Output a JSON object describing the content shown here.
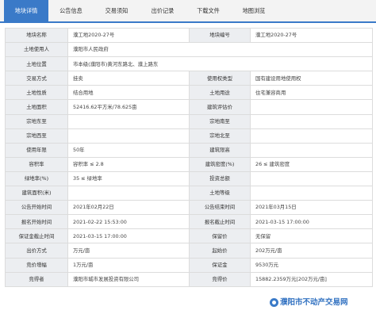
{
  "tabs": [
    "地块详情",
    "公告信息",
    "交易须知",
    "出价记录",
    "下载文件",
    "地图浏览"
  ],
  "rows": [
    [
      {
        "t": "l",
        "v": "地块名称"
      },
      {
        "t": "v",
        "v": "濮工地2020-27号"
      },
      {
        "t": "l",
        "v": "地块编号"
      },
      {
        "t": "v",
        "v": "濮工地2020-27号"
      }
    ],
    [
      {
        "t": "l",
        "v": "土地使用人"
      },
      {
        "t": "v",
        "v": "濮阳市人民政府",
        "cs": 3
      }
    ],
    [
      {
        "t": "l",
        "v": "土地位置"
      },
      {
        "t": "v",
        "v": "市本级(濮阳市)黄河东路北、濮上路东",
        "cs": 3
      }
    ],
    [
      {
        "t": "l",
        "v": "交易方式"
      },
      {
        "t": "v",
        "v": "挂卖"
      },
      {
        "t": "l",
        "v": "使用权类型"
      },
      {
        "t": "v",
        "v": "国有建设用地使用权"
      }
    ],
    [
      {
        "t": "l",
        "v": "土地性质"
      },
      {
        "t": "v",
        "v": "结合用地"
      },
      {
        "t": "l",
        "v": "土地用途"
      },
      {
        "t": "v",
        "v": "住宅兼容商用"
      }
    ],
    [
      {
        "t": "l",
        "v": "土地面积"
      },
      {
        "t": "v",
        "v": "52416.62平方米/78.625亩"
      },
      {
        "t": "l",
        "v": "建筑评估价"
      },
      {
        "t": "v",
        "v": ""
      }
    ],
    [
      {
        "t": "l",
        "v": "宗地东至"
      },
      {
        "t": "v",
        "v": ""
      },
      {
        "t": "l",
        "v": "宗地南至"
      },
      {
        "t": "v",
        "v": ""
      }
    ],
    [
      {
        "t": "l",
        "v": "宗地西至"
      },
      {
        "t": "v",
        "v": ""
      },
      {
        "t": "l",
        "v": "宗地北至"
      },
      {
        "t": "v",
        "v": ""
      }
    ],
    [
      {
        "t": "l",
        "v": "使用年限"
      },
      {
        "t": "v",
        "v": "50年"
      },
      {
        "t": "l",
        "v": "建筑限高"
      },
      {
        "t": "v",
        "v": ""
      }
    ],
    [
      {
        "t": "l",
        "v": "容积率"
      },
      {
        "t": "v",
        "v": "容积率 ≤ 2.8"
      },
      {
        "t": "l",
        "v": "建筑密度(%)"
      },
      {
        "t": "v",
        "v": "26 ≤ 建筑密度"
      }
    ],
    [
      {
        "t": "l",
        "v": "绿地率(%)"
      },
      {
        "t": "v",
        "v": "35 ≤ 绿地率"
      },
      {
        "t": "l",
        "v": "投资总额"
      },
      {
        "t": "v",
        "v": ""
      }
    ],
    [
      {
        "t": "l",
        "v": "建筑面积(米)"
      },
      {
        "t": "v",
        "v": ""
      },
      {
        "t": "l",
        "v": "土地等级"
      },
      {
        "t": "v",
        "v": ""
      }
    ],
    [
      {
        "t": "l",
        "v": "公告开始时间"
      },
      {
        "t": "v",
        "v": "2021年02月22日"
      },
      {
        "t": "l",
        "v": "公告结束时间"
      },
      {
        "t": "v",
        "v": "2021年03月15日"
      }
    ],
    [
      {
        "t": "l",
        "v": "报名开始时间"
      },
      {
        "t": "v",
        "v": "2021-02-22 15:53:00"
      },
      {
        "t": "l",
        "v": "报名截止时间"
      },
      {
        "t": "v",
        "v": "2021-03-15 17:00:00"
      }
    ],
    [
      {
        "t": "l",
        "v": "保证金截止时间"
      },
      {
        "t": "v",
        "v": "2021-03-15 17:00:00"
      },
      {
        "t": "l",
        "v": "保留价"
      },
      {
        "t": "v",
        "v": "无保留"
      }
    ],
    [
      {
        "t": "l",
        "v": "出价方式"
      },
      {
        "t": "v",
        "v": "万元/亩"
      },
      {
        "t": "l",
        "v": "起始价"
      },
      {
        "t": "v",
        "v": "202万元/亩"
      }
    ],
    [
      {
        "t": "l",
        "v": "竞价增幅"
      },
      {
        "t": "v",
        "v": "1万元/亩"
      },
      {
        "t": "l",
        "v": "保证金"
      },
      {
        "t": "v",
        "v": "9530万元"
      }
    ],
    [
      {
        "t": "l",
        "v": "竞得者"
      },
      {
        "t": "v",
        "v": "濮阳市城市发展投资有限公司"
      },
      {
        "t": "l",
        "v": "竞得价"
      },
      {
        "t": "v",
        "v": "15882.2359万元[202万元/亩]"
      }
    ]
  ],
  "watermark": "濮阳市不动产交易网"
}
